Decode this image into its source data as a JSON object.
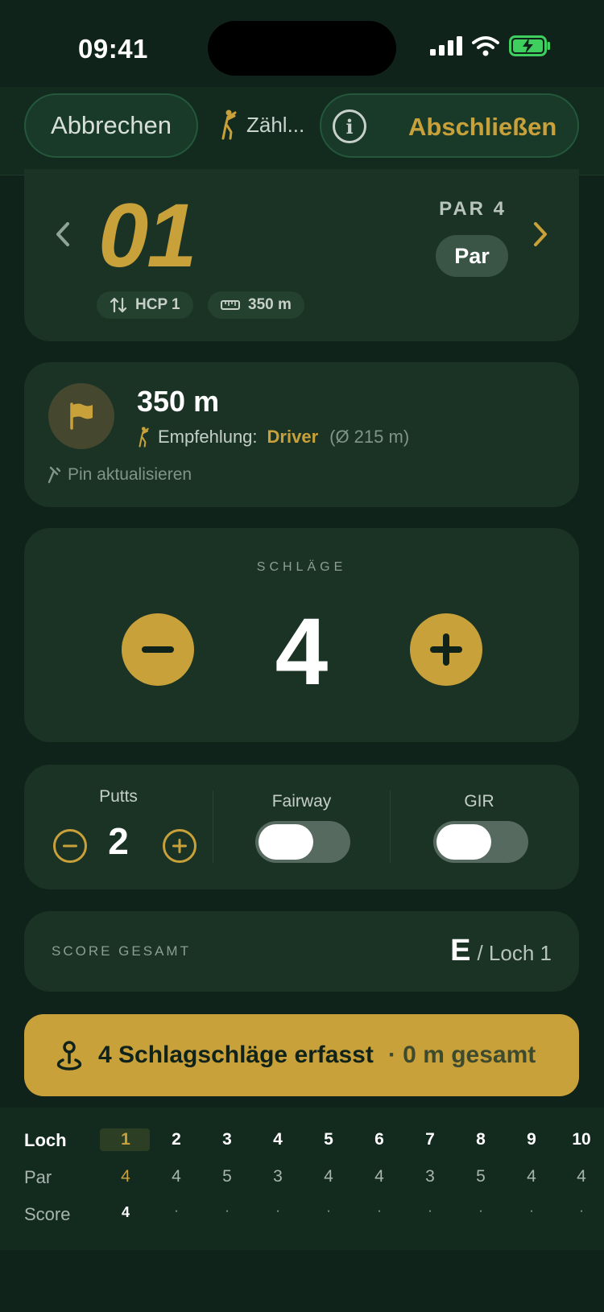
{
  "status": {
    "time": "09:41"
  },
  "nav": {
    "cancel_label": "Abbrechen",
    "mode_label": "Zähl...",
    "finish_label": "Abschließen"
  },
  "hole": {
    "number": "01",
    "par_caption": "PAR 4",
    "result_badge": "Par",
    "hcp": "HCP 1",
    "distance": "350 m"
  },
  "distance": {
    "value": "350 m",
    "recommendation_label": "Empfehlung:",
    "club": "Driver",
    "avg": "(Ø 215 m)",
    "pin_update": "Pin aktualisieren"
  },
  "strokes": {
    "caption": "SCHLÄGE",
    "value": "4"
  },
  "stats": {
    "putts_label": "Putts",
    "putts_value": "2",
    "fairway_label": "Fairway",
    "fairway_on": false,
    "gir_label": "GIR",
    "gir_on": false
  },
  "total": {
    "label": "SCORE GESAMT",
    "score": "E",
    "hole": "/ Loch 1"
  },
  "banner": {
    "main": "4 Schlagschläge erfasst",
    "sub": "· 0 m gesamt"
  },
  "scorecard": {
    "row_labels": [
      "Loch",
      "Par",
      "Score"
    ],
    "holes": [
      "1",
      "2",
      "3",
      "4",
      "5",
      "6",
      "7",
      "8",
      "9",
      "10"
    ],
    "pars": [
      "4",
      "4",
      "5",
      "3",
      "4",
      "4",
      "3",
      "5",
      "4",
      "4"
    ],
    "scores": [
      "4",
      "·",
      "·",
      "·",
      "·",
      "·",
      "·",
      "·",
      "·",
      "·"
    ]
  },
  "colors": {
    "background": "#10231a",
    "card": "#1a3325",
    "accent": "#c9a13a"
  }
}
